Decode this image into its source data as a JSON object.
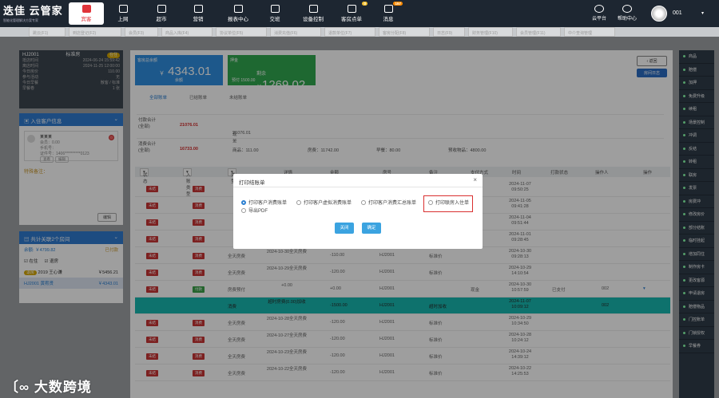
{
  "app": {
    "title": "迭佳 云管家",
    "subtitle": "智能化管理解决方案专家"
  },
  "nav": [
    {
      "label": "宾客",
      "active": true
    },
    {
      "label": "上网"
    },
    {
      "label": "超市"
    },
    {
      "label": "营销"
    },
    {
      "label": "报表中心"
    },
    {
      "label": "交班"
    },
    {
      "label": "设备控制"
    },
    {
      "label": "客房点单",
      "badge": "0"
    },
    {
      "label": "消息",
      "badge": "157"
    }
  ],
  "right_nav": [
    {
      "label": "云平台"
    },
    {
      "label": "帮助中心"
    }
  ],
  "user": {
    "name": "001"
  },
  "tabs": [
    "跳云(F1)",
    "到店登记(F2)",
    "会员(F3)",
    "商品入库(F4)",
    "协议单位(F5)",
    "消费充值(F6)",
    "退款单位(F7)",
    "客房分配(F8)",
    "日志(F9)",
    "财务管理(F10)",
    "会员管理(F11)",
    "中介查询管理"
  ],
  "room_panel": {
    "room_no": "HJ2001",
    "tag": "标准房",
    "status": "在住",
    "rows": [
      [
        "抵店时间",
        "2024-06-24 15:59:42"
      ],
      [
        "离店时间",
        "2024-11-25 12:00:00"
      ],
      [
        "今日房价",
        "110.00"
      ],
      [
        "参与活动",
        "无"
      ],
      [
        "今日早餐",
        "散客 / 标准"
      ],
      [
        "早餐卷",
        "1 张"
      ]
    ]
  },
  "guest_section": {
    "title": "入住客户信息",
    "name": "某某某",
    "sub1": "会员：0.00",
    "sub2": "手机号：",
    "sub3": "证件号：1406**********0123",
    "btn1": "查看",
    "btn2": "编辑",
    "remark_label": "特殊备注：",
    "edit_btn": "编辑"
  },
  "bill_section": {
    "title": "共计关联2个房间",
    "balance_label": "余额",
    "balance": "￥4799.82",
    "pay_label": "已付款",
    "cb1": "在住",
    "cb2": "退房",
    "rows": [
      {
        "tag": "退房",
        "name": "2019 王心谦",
        "amt": "￥5456.21"
      },
      {
        "tag": "",
        "name": "HJ2001 黄宥贤",
        "amt": "￥4343.01"
      }
    ]
  },
  "balance_card": {
    "label": "客房总余额",
    "amount": "4343.01",
    "unit": "余额",
    "symbol": "￥"
  },
  "deposit_card": {
    "label": "押金",
    "amount": "1269.02",
    "unit": "剩余",
    "symbol": "￥",
    "note": "预付 1500.00"
  },
  "subtabs": [
    "全部账单",
    "已结账单",
    "未结账单"
  ],
  "summary": {
    "pay_total_label": "付款合计\n(全部)",
    "pay_total": "21076.01",
    "cash_label": "现金",
    "cash": "21076.01",
    "consume_total_label": "消费合计\n(全部)",
    "consume_total": "16733.00",
    "items": [
      "商品：111.00",
      "房费：11742.00",
      "早餐：80.00",
      "预收物品：4800.00"
    ]
  },
  "table_head": [
    "状态",
    "入账类型",
    "类型",
    "详情",
    "金额",
    "房号",
    "备注",
    "支付方式",
    "时间",
    "打款状态",
    "操作人",
    "操作"
  ],
  "rows": [
    {
      "s": "未结",
      "t": "消费",
      "type": "",
      "detail": "",
      "amt": "",
      "room": "",
      "note": "",
      "pay": "",
      "time": "2024-11-07 09:50:25",
      "ps": "",
      "op": "",
      "hl": false
    },
    {
      "s": "未结",
      "t": "消费",
      "type": "",
      "detail": "",
      "amt": "",
      "room": "",
      "note": "",
      "pay": "",
      "time": "2024-11-05 09:41:28",
      "ps": "",
      "op": "",
      "hl": false
    },
    {
      "s": "未结",
      "t": "消费",
      "type": "",
      "detail": "",
      "amt": "",
      "room": "",
      "note": "",
      "pay": "",
      "time": "2024-11-04 09:51:44",
      "ps": "",
      "op": "",
      "hl": false
    },
    {
      "s": "未结",
      "t": "消费",
      "type": "",
      "detail": "",
      "amt": "",
      "room": "",
      "note": "",
      "pay": "",
      "time": "2024-11-01 09:28:45",
      "ps": "",
      "op": "",
      "hl": false
    },
    {
      "s": "未结",
      "t": "消费",
      "type": "全天房费",
      "detail": "2024-10-30全天房费",
      "amt": "-110.00",
      "room": "HJ2001",
      "note": "标准价",
      "pay": "",
      "time": "2024-10-30 09:28:13",
      "ps": "",
      "op": "",
      "hl": false
    },
    {
      "s": "未结",
      "t": "消费",
      "type": "全天房费",
      "detail": "2024-10-29全天房费",
      "amt": "-120.00",
      "room": "HJ2001",
      "note": "标准价",
      "pay": "",
      "time": "2024-10-29 14:10:54",
      "ps": "",
      "op": "",
      "hl": false
    },
    {
      "s": "未结",
      "t": "付款",
      "type": "房费预付",
      "detail": "+0.00",
      "amt": "+0.00",
      "room": "HJ2001",
      "note": "",
      "pay": "现金",
      "time": "2024-10-30 10:57:59",
      "ps": "已支付",
      "op": "002",
      "hl": false
    },
    {
      "s": "",
      "t": "",
      "type": "消费",
      "detail": "超时房费(0.00)加收",
      "amt": "-1500.00",
      "room": "HJ2001",
      "note": "超时加收",
      "pay": "",
      "time": "2024-11-07 10:09:12",
      "ps": "",
      "op": "002",
      "hl": true
    },
    {
      "s": "未结",
      "t": "消费",
      "type": "全天房费",
      "detail": "2024-10-28全天房费",
      "amt": "-120.00",
      "room": "HJ2001",
      "note": "标准价",
      "pay": "",
      "time": "2024-10-29 10:34:50",
      "ps": "",
      "op": "",
      "hl": false
    },
    {
      "s": "未结",
      "t": "消费",
      "type": "全天房费",
      "detail": "2024-10-27全天房费",
      "amt": "-120.00",
      "room": "HJ2001",
      "note": "标准价",
      "pay": "",
      "time": "2024-10-28 10:24:12",
      "ps": "",
      "op": "",
      "hl": false
    },
    {
      "s": "未结",
      "t": "消费",
      "type": "全天房费",
      "detail": "2024-10-23全天房费",
      "amt": "-120.00",
      "room": "HJ2001",
      "note": "标准价",
      "pay": "",
      "time": "2024-10-24 14:39:12",
      "ps": "",
      "op": "",
      "hl": false
    },
    {
      "s": "未结",
      "t": "消费",
      "type": "全天房费",
      "detail": "2024-10-22全天房费",
      "amt": "-120.00",
      "room": "HJ2001",
      "note": "标准价",
      "pay": "",
      "time": "2024-10-22 14:25:53",
      "ps": "",
      "op": "",
      "hl": false
    }
  ],
  "right_buttons": {
    "back": "返回",
    "log": "房间日志"
  },
  "menu": [
    "商品",
    "赔偿",
    "加押",
    "免费升级",
    "续租",
    "场景控制",
    "冲调",
    "反结",
    "转租",
    "联房",
    "发票",
    "房费冲",
    "修改房价",
    "部分结账",
    "临时挂起",
    "增加同住",
    "制作房卡",
    "更改客源",
    "申请退房",
    "赔偿物品",
    "门控账单",
    "门锁授权",
    "早餐券"
  ],
  "dialog": {
    "title": "打印结账单",
    "close": "×",
    "options": [
      "打印客户消费账单",
      "打印客户虚拟消费账单",
      "打印客户消费汇总账单",
      "打印联房入住单",
      "导出PDF"
    ],
    "selected": 0,
    "btn_close": "关闭",
    "btn_ok": "确定"
  },
  "watermark": "大数跨境"
}
